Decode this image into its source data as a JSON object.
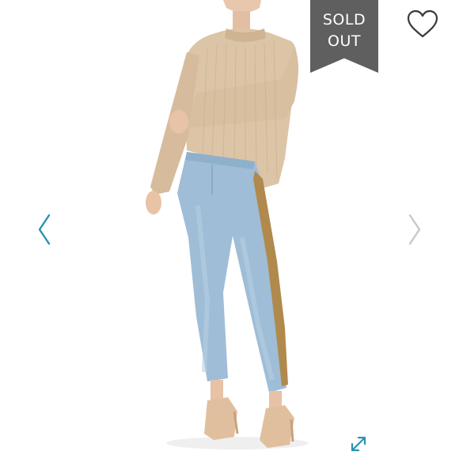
{
  "badge": {
    "line1": "SOLD",
    "line2": "OUT"
  },
  "icons": {
    "favorite": "heart-icon",
    "previous": "chevron-left-icon",
    "next": "chevron-right-icon",
    "expand": "expand-icon"
  },
  "colors": {
    "badge_bg": "#5f5f5f",
    "accent": "#2a93b0",
    "next_arrow": "#c8c8c8",
    "icon_outline": "#3a3a3a"
  }
}
